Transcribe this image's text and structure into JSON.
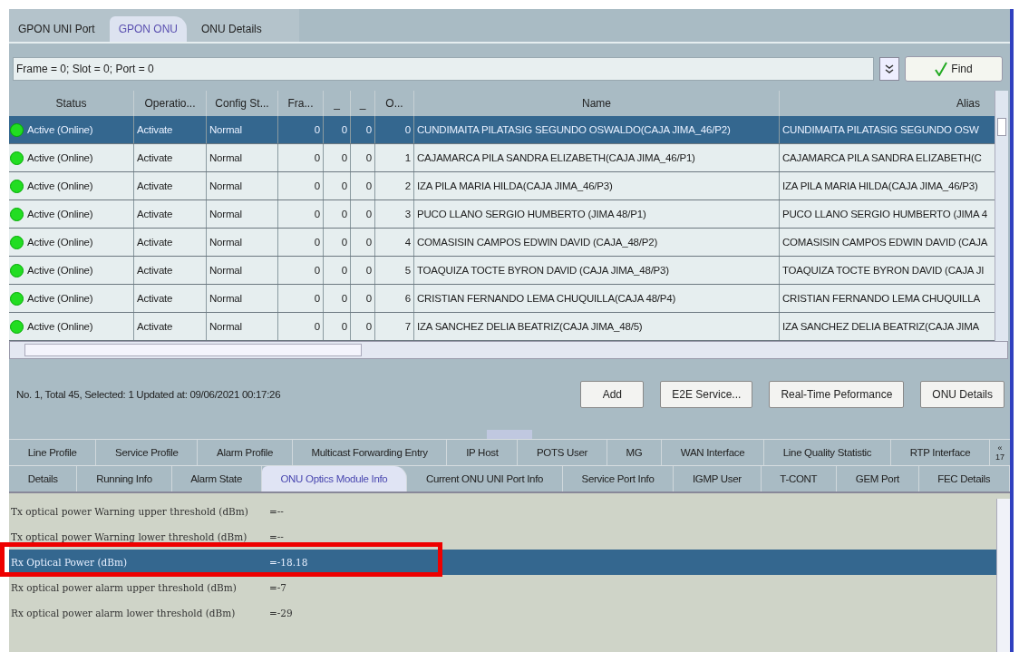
{
  "top_tabs": [
    {
      "label": "GPON UNI Port",
      "selected": false
    },
    {
      "label": "GPON ONU",
      "selected": true
    },
    {
      "label": "ONU Details",
      "selected": false
    }
  ],
  "filter": {
    "value": "Frame = 0; Slot = 0; Port = 0",
    "find_button": "Find"
  },
  "table": {
    "columns": [
      "Status",
      "Operatio...",
      "Config St...",
      "Fra...",
      "_",
      "_",
      "O...",
      "Name",
      "Alias"
    ],
    "rows": [
      {
        "selected": true,
        "color": "#22dd22",
        "cells": [
          "Active (Online)",
          "Activate",
          "Normal",
          "0",
          "0",
          "0",
          "0",
          "CUNDIMAITA PILATASIG SEGUNDO OSWALDO(CAJA JIMA_46/P2)",
          "CUNDIMAITA PILATASIG SEGUNDO OSW"
        ]
      },
      {
        "selected": false,
        "color": "#22dd22",
        "cells": [
          "Active (Online)",
          "Activate",
          "Normal",
          "0",
          "0",
          "0",
          "1",
          "CAJAMARCA PILA SANDRA ELIZABETH(CAJA JIMA_46/P1)",
          "CAJAMARCA PILA SANDRA ELIZABETH(C"
        ]
      },
      {
        "selected": false,
        "color": "#22dd22",
        "cells": [
          "Active (Online)",
          "Activate",
          "Normal",
          "0",
          "0",
          "0",
          "2",
          "IZA PILA MARIA HILDA(CAJA JIMA_46/P3)",
          "IZA PILA MARIA HILDA(CAJA JIMA_46/P3)"
        ]
      },
      {
        "selected": false,
        "color": "#22dd22",
        "cells": [
          "Active (Online)",
          "Activate",
          "Normal",
          "0",
          "0",
          "0",
          "3",
          "PUCO LLANO SERGIO HUMBERTO (JIMA 48/P1)",
          "PUCO LLANO SERGIO HUMBERTO (JIMA 4"
        ]
      },
      {
        "selected": false,
        "color": "#22dd22",
        "cells": [
          "Active (Online)",
          "Activate",
          "Normal",
          "0",
          "0",
          "0",
          "4",
          "COMASISIN CAMPOS EDWIN DAVID (CAJA_48/P2)",
          "COMASISIN CAMPOS EDWIN DAVID (CAJA"
        ]
      },
      {
        "selected": false,
        "color": "#22dd22",
        "cells": [
          "Active (Online)",
          "Activate",
          "Normal",
          "0",
          "0",
          "0",
          "5",
          "TOAQUIZA TOCTE BYRON DAVID (CAJA JIMA_48/P3)",
          "TOAQUIZA TOCTE BYRON DAVID (CAJA JI"
        ]
      },
      {
        "selected": false,
        "color": "#22dd22",
        "cells": [
          "Active (Online)",
          "Activate",
          "Normal",
          "0",
          "0",
          "0",
          "6",
          "CRISTIAN FERNANDO LEMA CHUQUILLA(CAJA 48/P4)",
          "CRISTIAN FERNANDO LEMA CHUQUILLA"
        ]
      },
      {
        "selected": false,
        "color": "#22dd22",
        "cells": [
          "Active (Online)",
          "Activate",
          "Normal",
          "0",
          "0",
          "0",
          "7",
          "IZA SANCHEZ DELIA BEATRIZ(CAJA JIMA_48/5)",
          "IZA SANCHEZ DELIA BEATRIZ(CAJA JIMA"
        ]
      }
    ]
  },
  "status_text": "No. 1, Total 45, Selected: 1   Updated at: 09/06/2021 00:17:26",
  "buttons": [
    "Add",
    "E2E Service...",
    "Real-Time Peformance",
    "ONU Details"
  ],
  "tabs_row_1": [
    {
      "label": "Line Profile",
      "selected": false
    },
    {
      "label": "Service Profile",
      "selected": false
    },
    {
      "label": "Alarm Profile",
      "selected": false
    },
    {
      "label": "Multicast Forwarding Entry",
      "selected": false
    },
    {
      "label": "IP Host",
      "selected": false
    },
    {
      "label": "POTS User",
      "selected": false
    },
    {
      "label": "MG",
      "selected": false
    },
    {
      "label": "WAN Interface",
      "selected": false
    },
    {
      "label": "Line Quality Statistic",
      "selected": false
    },
    {
      "label": "RTP Interface",
      "selected": false
    }
  ],
  "tabs_more": {
    "arrow": "«",
    "count": "17"
  },
  "tabs_row_2": [
    {
      "label": "Details",
      "selected": false
    },
    {
      "label": "Running Info",
      "selected": false
    },
    {
      "label": "Alarm State",
      "selected": false
    },
    {
      "label": "ONU Optics Module Info",
      "selected": true
    },
    {
      "label": "Current ONU UNI Port Info",
      "selected": false
    },
    {
      "label": "Service Port Info",
      "selected": false
    },
    {
      "label": "IGMP User",
      "selected": false
    },
    {
      "label": "T-CONT",
      "selected": false
    },
    {
      "label": "GEM Port",
      "selected": false
    },
    {
      "label": "FEC Details",
      "selected": false
    }
  ],
  "details": [
    {
      "label": "Tx optical power Warning upper threshold (dBm)",
      "value": "=--",
      "selected": false,
      "highlighted": false
    },
    {
      "label": "Tx optical power Warning lower threshold (dBm)",
      "value": "=--",
      "selected": false,
      "highlighted": false
    },
    {
      "label": "Rx Optical Power (dBm)",
      "value": "=-18.18",
      "selected": true,
      "highlighted": true
    },
    {
      "label": "Rx optical power alarm upper threshold (dBm)",
      "value": "=-7",
      "selected": false,
      "highlighted": false
    },
    {
      "label": "Rx optical power alarm lower threshold (dBm)",
      "value": "=-29",
      "selected": false,
      "highlighted": false
    }
  ]
}
